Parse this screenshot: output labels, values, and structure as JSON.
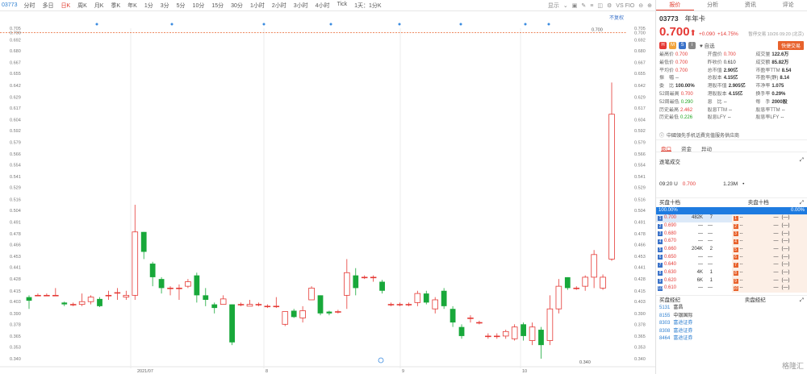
{
  "toolbar": {
    "code": "03773",
    "intervals": [
      "分时",
      "多日",
      "日K",
      "周K",
      "月K",
      "季K",
      "年K",
      "1分",
      "3分",
      "5分",
      "10分",
      "15分",
      "30分",
      "1小时",
      "2小时",
      "3小时",
      "4小时",
      "Tick",
      "1天：1分K"
    ],
    "active_index": 2,
    "display_label": "显示",
    "vs_label": "VS FIO",
    "adjust_label": "不复权"
  },
  "chart_data": {
    "type": "candlestick",
    "y_ticks": [
      "0.705",
      "0.700",
      "0.692",
      "0.680",
      "0.667",
      "0.655",
      "0.642",
      "0.629",
      "0.617",
      "0.604",
      "0.592",
      "0.579",
      "0.566",
      "0.554",
      "0.541",
      "0.529",
      "0.516",
      "0.504",
      "0.491",
      "0.478",
      "0.466",
      "0.453",
      "0.441",
      "0.428",
      "0.415",
      "0.403",
      "0.390",
      "0.378",
      "0.365",
      "0.353",
      "0.340"
    ],
    "ylim": [
      0.34,
      0.705
    ],
    "x_labels": [
      "2021/07",
      "8",
      "9",
      "10"
    ],
    "reference_line": 0.7,
    "max_label": "0.700",
    "min_label": "0.340",
    "candles": [
      {
        "o": 0.408,
        "c": 0.404,
        "h": 0.41,
        "l": 0.395
      },
      {
        "o": 0.41,
        "c": 0.41,
        "h": 0.412,
        "l": 0.409
      },
      {
        "o": 0.41,
        "c": 0.41,
        "h": 0.412,
        "l": 0.409
      },
      {
        "o": 0.41,
        "c": 0.41,
        "h": 0.418,
        "l": 0.409
      },
      {
        "o": 0.402,
        "c": 0.4,
        "h": 0.403,
        "l": 0.398
      },
      {
        "o": 0.4,
        "c": 0.4,
        "h": 0.402,
        "l": 0.398
      },
      {
        "o": 0.4,
        "c": 0.403,
        "h": 0.412,
        "l": 0.398
      },
      {
        "o": 0.403,
        "c": 0.408,
        "h": 0.41,
        "l": 0.4
      },
      {
        "o": 0.406,
        "c": 0.398,
        "h": 0.408,
        "l": 0.397
      },
      {
        "o": 0.41,
        "c": 0.41,
        "h": 0.415,
        "l": 0.405
      },
      {
        "o": 0.413,
        "c": 0.413,
        "h": 0.418,
        "l": 0.405
      },
      {
        "o": 0.408,
        "c": 0.41,
        "h": 0.415,
        "l": 0.405
      },
      {
        "o": 0.41,
        "c": 0.48,
        "h": 0.51,
        "l": 0.405
      },
      {
        "o": 0.48,
        "c": 0.458,
        "h": 0.48,
        "l": 0.45
      },
      {
        "o": 0.445,
        "c": 0.43,
        "h": 0.447,
        "l": 0.42
      },
      {
        "o": 0.428,
        "c": 0.418,
        "h": 0.43,
        "l": 0.412
      },
      {
        "o": 0.418,
        "c": 0.418,
        "h": 0.42,
        "l": 0.41
      },
      {
        "o": 0.418,
        "c": 0.418,
        "h": 0.422,
        "l": 0.405
      },
      {
        "o": 0.42,
        "c": 0.425,
        "h": 0.428,
        "l": 0.418
      },
      {
        "o": 0.432,
        "c": 0.41,
        "h": 0.435,
        "l": 0.402
      },
      {
        "o": 0.41,
        "c": 0.405,
        "h": 0.418,
        "l": 0.398
      },
      {
        "o": 0.4,
        "c": 0.396,
        "h": 0.402,
        "l": 0.39
      },
      {
        "o": 0.4,
        "c": 0.406,
        "h": 0.41,
        "l": 0.4
      },
      {
        "o": 0.4,
        "c": 0.358,
        "h": 0.4,
        "l": 0.355
      },
      {
        "o": 0.4,
        "c": 0.4,
        "h": 0.402,
        "l": 0.398
      },
      {
        "o": 0.398,
        "c": 0.4,
        "h": 0.405,
        "l": 0.398
      },
      {
        "o": 0.4,
        "c": 0.4,
        "h": 0.402,
        "l": 0.398
      },
      {
        "o": 0.398,
        "c": 0.398,
        "h": 0.4,
        "l": 0.396
      },
      {
        "o": 0.398,
        "c": 0.398,
        "h": 0.408,
        "l": 0.396
      },
      {
        "o": 0.378,
        "c": 0.392,
        "h": 0.392,
        "l": 0.376
      },
      {
        "o": 0.393,
        "c": 0.386,
        "h": 0.395,
        "l": 0.385
      },
      {
        "o": 0.385,
        "c": 0.393,
        "h": 0.398,
        "l": 0.38
      },
      {
        "o": 0.405,
        "c": 0.418,
        "h": 0.42,
        "l": 0.405
      },
      {
        "o": 0.41,
        "c": 0.39,
        "h": 0.41,
        "l": 0.388
      },
      {
        "o": 0.392,
        "c": 0.39,
        "h": 0.393,
        "l": 0.388
      },
      {
        "o": 0.392,
        "c": 0.392,
        "h": 0.394,
        "l": 0.39
      },
      {
        "o": 0.41,
        "c": 0.435,
        "h": 0.45,
        "l": 0.395
      },
      {
        "o": 0.432,
        "c": 0.418,
        "h": 0.44,
        "l": 0.41
      },
      {
        "o": 0.43,
        "c": 0.43,
        "h": 0.432,
        "l": 0.428
      },
      {
        "o": 0.43,
        "c": 0.43,
        "h": 0.432,
        "l": 0.425
      },
      {
        "o": 0.425,
        "c": 0.415,
        "h": 0.427,
        "l": 0.412
      },
      {
        "o": 0.4,
        "c": 0.4,
        "h": 0.402,
        "l": 0.398
      },
      {
        "o": 0.4,
        "c": 0.4,
        "h": 0.402,
        "l": 0.398
      },
      {
        "o": 0.4,
        "c": 0.4,
        "h": 0.402,
        "l": 0.398
      },
      {
        "o": 0.402,
        "c": 0.412,
        "h": 0.415,
        "l": 0.398
      },
      {
        "o": 0.412,
        "c": 0.402,
        "h": 0.415,
        "l": 0.4
      },
      {
        "o": 0.395,
        "c": 0.405,
        "h": 0.408,
        "l": 0.39
      },
      {
        "o": 0.415,
        "c": 0.398,
        "h": 0.418,
        "l": 0.395
      },
      {
        "o": 0.395,
        "c": 0.38,
        "h": 0.398,
        "l": 0.375
      },
      {
        "o": 0.375,
        "c": 0.365,
        "h": 0.378,
        "l": 0.362
      },
      {
        "o": 0.385,
        "c": 0.385,
        "h": 0.388,
        "l": 0.38
      },
      {
        "o": 0.38,
        "c": 0.38,
        "h": 0.382,
        "l": 0.378
      },
      {
        "o": 0.365,
        "c": 0.365,
        "h": 0.368,
        "l": 0.362
      },
      {
        "o": 0.365,
        "c": 0.365,
        "h": 0.368,
        "l": 0.362
      },
      {
        "o": 0.365,
        "c": 0.37,
        "h": 0.372,
        "l": 0.362
      },
      {
        "o": 0.362,
        "c": 0.375,
        "h": 0.378,
        "l": 0.36
      },
      {
        "o": 0.378,
        "c": 0.365,
        "h": 0.38,
        "l": 0.36
      },
      {
        "o": 0.36,
        "c": 0.375,
        "h": 0.38,
        "l": 0.355
      },
      {
        "o": 0.372,
        "c": 0.355,
        "h": 0.375,
        "l": 0.34
      },
      {
        "o": 0.36,
        "c": 0.395,
        "h": 0.41,
        "l": 0.355
      },
      {
        "o": 0.395,
        "c": 0.42,
        "h": 0.428,
        "l": 0.39
      },
      {
        "o": 0.43,
        "c": 0.418,
        "h": 0.43,
        "l": 0.416
      },
      {
        "o": 0.418,
        "c": 0.418,
        "h": 0.42,
        "l": 0.416
      },
      {
        "o": 0.42,
        "c": 0.43,
        "h": 0.432,
        "l": 0.415
      },
      {
        "o": 0.43,
        "c": 0.455,
        "h": 0.46,
        "l": 0.418
      },
      {
        "o": 0.418,
        "c": 0.43,
        "h": 0.433,
        "l": 0.416
      },
      {
        "o": 0.45,
        "c": 0.61,
        "h": 0.645,
        "l": 0.448
      }
    ]
  },
  "panel": {
    "tabs": [
      "报价",
      "分析",
      "资讯",
      "评论"
    ],
    "code": "03773",
    "name": "年年卡",
    "price": "0.700",
    "arrow": "⬆",
    "change": "+0.090",
    "change_pct": "+14.75%",
    "status": "暂停交易 10/26 09:20 (北京)",
    "watch_label": "自选",
    "quick_label": "快捷交易",
    "stats": [
      [
        [
          "最高价",
          "0.700",
          "red"
        ],
        [
          "开盘价",
          "0.700",
          "red"
        ],
        [
          "成交量",
          "122.6万",
          "b"
        ]
      ],
      [
        [
          "最低价",
          "0.700",
          "red"
        ],
        [
          "昨收价",
          "0.610",
          ""
        ],
        [
          "成交额",
          "85.82万",
          "b"
        ]
      ],
      [
        [
          "平均价",
          "0.700",
          "red"
        ],
        [
          "总市值",
          "2.90亿",
          "b"
        ],
        [
          "市盈率TTM",
          "8.54",
          "b"
        ]
      ],
      [
        [
          "振　幅",
          "--",
          ""
        ],
        [
          "总股本",
          "4.15亿",
          "b"
        ],
        [
          "市盈率(静)",
          "8.14",
          "b"
        ]
      ],
      [
        [
          "委　比",
          "100.00%",
          "b"
        ],
        [
          "港股市值",
          "2.905亿",
          "b"
        ],
        [
          "市净率",
          "1.075",
          "b"
        ]
      ],
      [
        [
          "52周最高",
          "0.700",
          "red"
        ],
        [
          "港股股本",
          "4.15亿",
          "b"
        ],
        [
          "换手率",
          "0.29%",
          "b"
        ]
      ],
      [
        [
          "52周最低",
          "0.290",
          "green"
        ],
        [
          "息　比",
          "--",
          ""
        ],
        [
          "每　手",
          "2000股",
          "b"
        ]
      ],
      [
        [
          "历史最高",
          "2.462",
          "red"
        ],
        [
          "股息TTM",
          "--",
          ""
        ],
        [
          "股息率TTM",
          "--",
          ""
        ]
      ],
      [
        [
          "历史最低",
          "0.226",
          "green"
        ],
        [
          "股息LFY",
          "--",
          ""
        ],
        [
          "股息率LFY",
          "--",
          ""
        ]
      ]
    ],
    "news": "中國領先手机话費充值服务供应商",
    "sub_tabs": [
      "盘口",
      "资金",
      "异动"
    ],
    "ticks_title": "逐笔成交",
    "tick_time": "09:20 U",
    "tick_price": "0.700",
    "tick_vol": "1.23M",
    "buy_title": "买盘十档",
    "sell_title": "卖盘十档",
    "buy_pct": "100.00%",
    "sell_pct": "0.00%",
    "bids": [
      [
        "1",
        "0.700",
        "482K",
        "7"
      ],
      [
        "2",
        "0.690",
        "—",
        "—"
      ],
      [
        "3",
        "0.680",
        "—",
        "—"
      ],
      [
        "4",
        "0.670",
        "—",
        "—"
      ],
      [
        "5",
        "0.660",
        "204K",
        "2"
      ],
      [
        "6",
        "0.650",
        "—",
        "—"
      ],
      [
        "7",
        "0.640",
        "—",
        "—"
      ],
      [
        "8",
        "0.630",
        "4K",
        "1"
      ],
      [
        "9",
        "0.620",
        "6K",
        "1"
      ],
      [
        "10",
        "0.610",
        "—",
        "—"
      ]
    ],
    "asks": [
      "1",
      "2",
      "3",
      "4",
      "5",
      "6",
      "7",
      "8",
      "9",
      "10"
    ],
    "buy_broker_title": "买盘经纪",
    "sell_broker_title": "卖盘经纪",
    "brokers": [
      [
        "5131",
        "富昌",
        false
      ],
      [
        "8155",
        "中银国际",
        false
      ],
      [
        "8303",
        "富途证券",
        true
      ],
      [
        "8308",
        "富途证券",
        true
      ],
      [
        "8464",
        "富途证券",
        true
      ]
    ]
  },
  "watermark": "格隆汇"
}
